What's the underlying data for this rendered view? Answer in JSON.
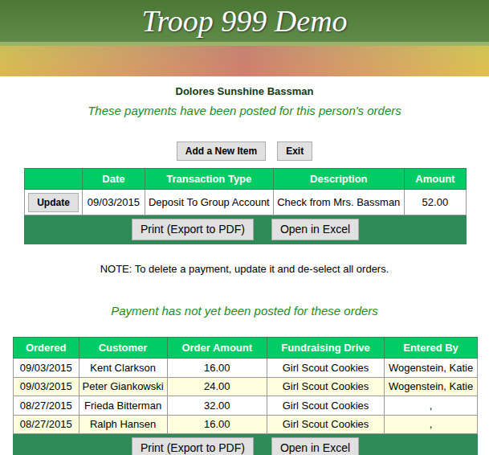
{
  "site": {
    "title": "Troop 999 Demo"
  },
  "person": "Dolores Sunshine Bassman",
  "posted": {
    "heading": "These payments have been posted for this person's orders",
    "buttons": [
      "Add a New Item",
      "Exit"
    ],
    "columns": [
      "Date",
      "Transaction Type",
      "Description",
      "Amount"
    ],
    "rows": [
      {
        "action": "Update",
        "date": "09/03/2015",
        "type": "Deposit To Group Account",
        "description": "Check from Mrs. Bassman",
        "amount": "52.00"
      }
    ],
    "footer_buttons": [
      "Print (Export to PDF)",
      "Open in Excel"
    ]
  },
  "note": "NOTE: To delete a payment, update it and de-select all orders.",
  "unposted": {
    "heading": "Payment has not yet been posted for these orders",
    "columns": [
      "Ordered",
      "Customer",
      "Order Amount",
      "Fundraising Drive",
      "Entered By"
    ],
    "rows": [
      {
        "ordered": "09/03/2015",
        "customer": "Kent Clarkson",
        "amount": "16.00",
        "drive": "Girl Scout Cookies",
        "entered_by": "Wogenstein, Katie"
      },
      {
        "ordered": "09/03/2015",
        "customer": "Peter Giankowski",
        "amount": "24.00",
        "drive": "Girl Scout Cookies",
        "entered_by": "Wogenstein, Katie"
      },
      {
        "ordered": "08/27/2015",
        "customer": "Frieda Bitterman",
        "amount": "32.00",
        "drive": "Girl Scout Cookies",
        "entered_by": ","
      },
      {
        "ordered": "08/27/2015",
        "customer": "Ralph Hansen",
        "amount": "16.00",
        "drive": "Girl Scout Cookies",
        "entered_by": ","
      }
    ],
    "footer_buttons": [
      "Print (Export to PDF)",
      "Open in Excel"
    ]
  }
}
